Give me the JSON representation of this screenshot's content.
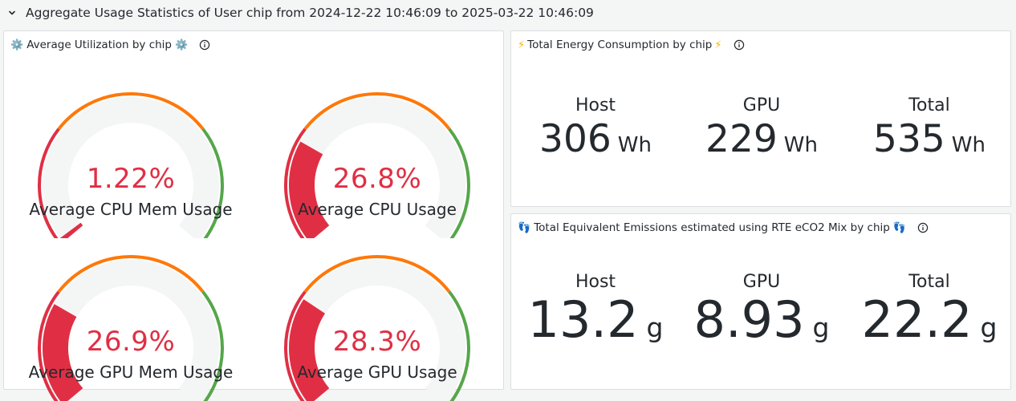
{
  "row": {
    "title": "Aggregate Usage Statistics of User chip from 2024-12-22 10:46:09 to 2025-03-22 10:46:09"
  },
  "utilization_panel": {
    "emoji": "⚙️",
    "title": "Average Utilization by chip",
    "gauges": [
      {
        "value_text": "1.22%",
        "value": 1.22,
        "label": "Average CPU Mem Usage"
      },
      {
        "value_text": "26.8%",
        "value": 26.8,
        "label": "Average CPU Usage"
      },
      {
        "value_text": "26.9%",
        "value": 26.9,
        "label": "Average GPU Mem Usage"
      },
      {
        "value_text": "28.3%",
        "value": 28.3,
        "label": "Average GPU Usage"
      }
    ],
    "thresholds": {
      "orange_start": 30,
      "green_start": 70,
      "max": 100
    },
    "colors": {
      "red": "#e02f44",
      "orange": "#ff780a",
      "green": "#56a64b",
      "track": "#f4f5f5"
    }
  },
  "energy_panel": {
    "emoji": "⚡",
    "title": "Total Energy Consumption by chip",
    "stats": [
      {
        "label": "Host",
        "value": "306",
        "unit": "Wh"
      },
      {
        "label": "GPU",
        "value": "229",
        "unit": "Wh"
      },
      {
        "label": "Total",
        "value": "535",
        "unit": "Wh"
      }
    ]
  },
  "emissions_panel": {
    "emoji": "👣",
    "title": "Total Equivalent Emissions estimated using RTE eCO2 Mix by chip",
    "stats": [
      {
        "label": "Host",
        "value": "13.2",
        "unit": "g"
      },
      {
        "label": "GPU",
        "value": "8.93",
        "unit": "g"
      },
      {
        "label": "Total",
        "value": "22.2",
        "unit": "g"
      }
    ]
  }
}
